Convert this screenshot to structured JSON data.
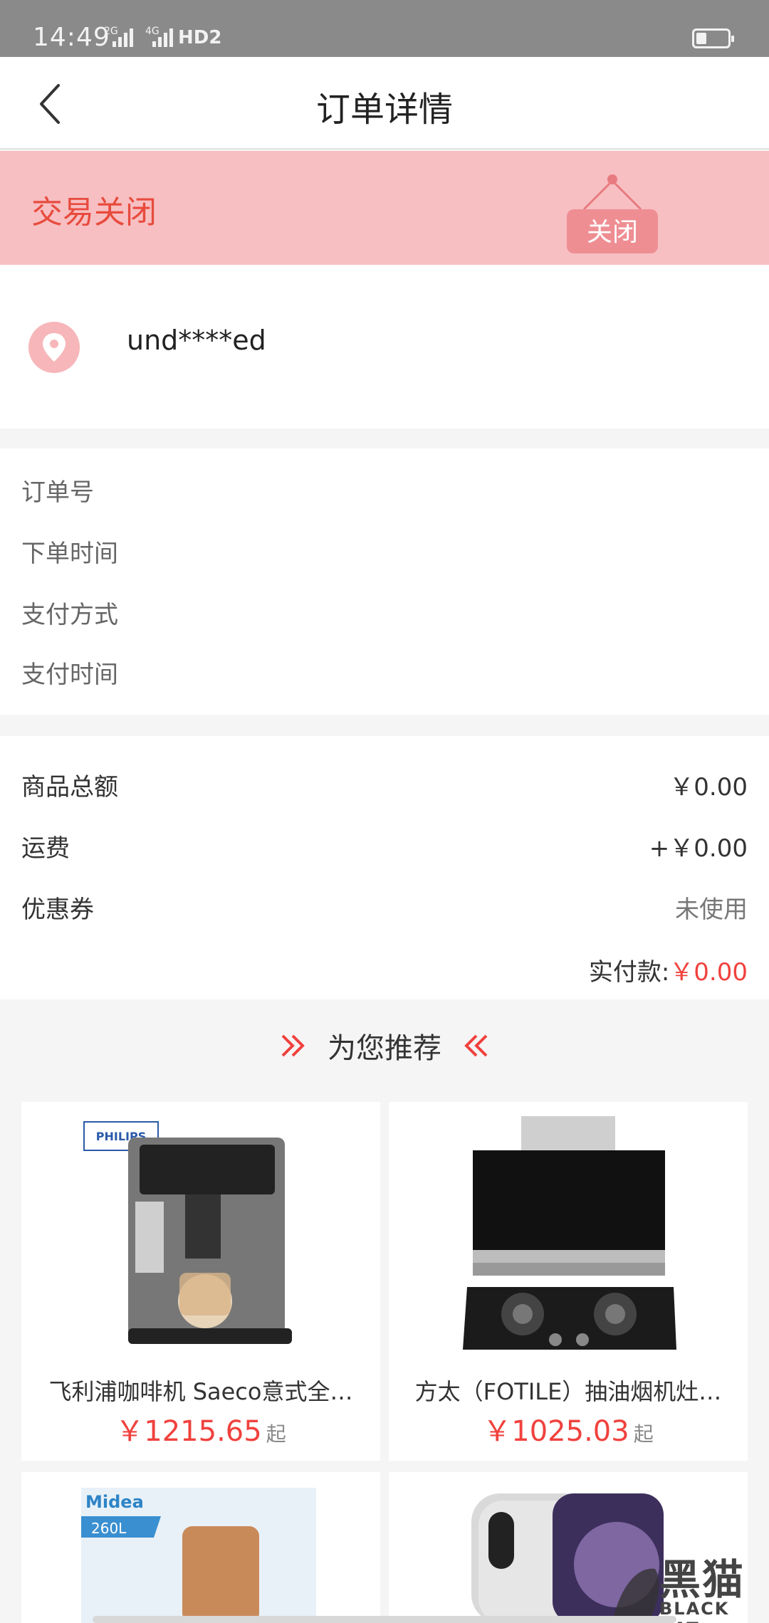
{
  "status_bar": {
    "time": "14:49",
    "net1": "2G",
    "net2": "4G",
    "hd": "HD2"
  },
  "nav": {
    "title": "订单详情",
    "back_icon": "chevron-left-icon"
  },
  "order_status": {
    "text": "交易关闭",
    "sign_text": "关闭",
    "color": "#e84b3d",
    "bg": "#f7bfc2"
  },
  "address": {
    "icon": "location-pin-icon",
    "text": "und****ed"
  },
  "order_info": {
    "rows": [
      {
        "label": "订单号"
      },
      {
        "label": "下单时间"
      },
      {
        "label": "支付方式"
      },
      {
        "label": "支付时间"
      }
    ]
  },
  "cost": {
    "rows": [
      {
        "label": "商品总额",
        "value": "￥0.00"
      },
      {
        "label": "运费",
        "value": "+￥0.00"
      },
      {
        "label": "优惠券",
        "value": "未使用"
      }
    ],
    "actual_label": "实付款:",
    "actual_value": "￥0.00"
  },
  "recommend": {
    "title": "为您推荐",
    "products": [
      {
        "name": "飞利浦咖啡机 Saeco意式全…",
        "price": "￥1215.65",
        "suffix": "起",
        "image": "coffee-machine-image",
        "brand": "PHILIPS"
      },
      {
        "name": "方太（FOTILE）抽油烟机灶…",
        "price": "￥1025.03",
        "suffix": "起",
        "image": "range-hood-stove-image"
      },
      {
        "name": "",
        "price": "",
        "suffix": "",
        "image": "water-heater-image",
        "brand": "Midea",
        "tag": "260L"
      },
      {
        "name": "",
        "price": "",
        "suffix": "",
        "image": "smartphone-image"
      }
    ]
  },
  "watermark": {
    "text": "黑猫",
    "sub": "BLACK CAT"
  },
  "colors": {
    "accent_red": "#f0413d",
    "banner_pink": "#f7bfc2"
  }
}
